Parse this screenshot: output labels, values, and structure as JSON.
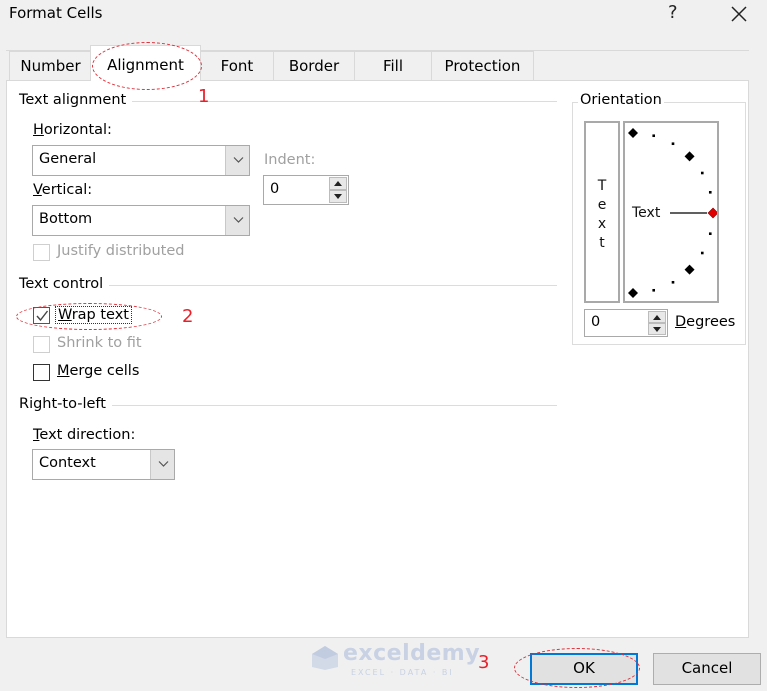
{
  "window": {
    "title": "Format Cells",
    "help_label": "?",
    "close_label": "✕"
  },
  "tabs": [
    {
      "label": "Number",
      "active": false
    },
    {
      "label": "Alignment",
      "active": true
    },
    {
      "label": "Font",
      "active": false
    },
    {
      "label": "Border",
      "active": false
    },
    {
      "label": "Fill",
      "active": false
    },
    {
      "label": "Protection",
      "active": false
    }
  ],
  "text_alignment": {
    "group_label": "Text alignment",
    "horizontal": {
      "label_mnemonic": "H",
      "label_rest": "orizontal:",
      "value": "General"
    },
    "vertical": {
      "label_mnemonic": "V",
      "label_rest": "ertical:",
      "value": "Bottom"
    },
    "indent": {
      "label": "Indent:",
      "value": "0"
    },
    "justify_distributed": {
      "label": "Justify distributed",
      "checked": false,
      "enabled": false
    }
  },
  "text_control": {
    "group_label": "Text control",
    "wrap_text": {
      "label_mnemonic": "W",
      "label_rest": "rap text",
      "checked": true
    },
    "shrink_to_fit": {
      "label": "Shrink to fit",
      "checked": false,
      "enabled": false
    },
    "merge_cells": {
      "label_mnemonic": "M",
      "label_rest": "erge cells",
      "checked": false
    }
  },
  "right_to_left": {
    "group_label": "Right-to-left",
    "text_direction": {
      "label_mnemonic": "T",
      "label_rest": "ext direction:",
      "value": "Context"
    }
  },
  "orientation": {
    "group_label": "Orientation",
    "vertical_text_letters": [
      "T",
      "e",
      "x",
      "t"
    ],
    "dial_text": "Text",
    "degrees_value": "0",
    "degrees_label_mnemonic": "D",
    "degrees_label_rest": "egrees",
    "angle_degrees": 0
  },
  "footer": {
    "ok_label": "OK",
    "cancel_label": "Cancel"
  },
  "annotations": {
    "step1": "1",
    "step2": "2",
    "step3": "3",
    "color": "#e8202a"
  },
  "watermark": {
    "name": "exceldemy",
    "tagline": "EXCEL · DATA · BI"
  }
}
